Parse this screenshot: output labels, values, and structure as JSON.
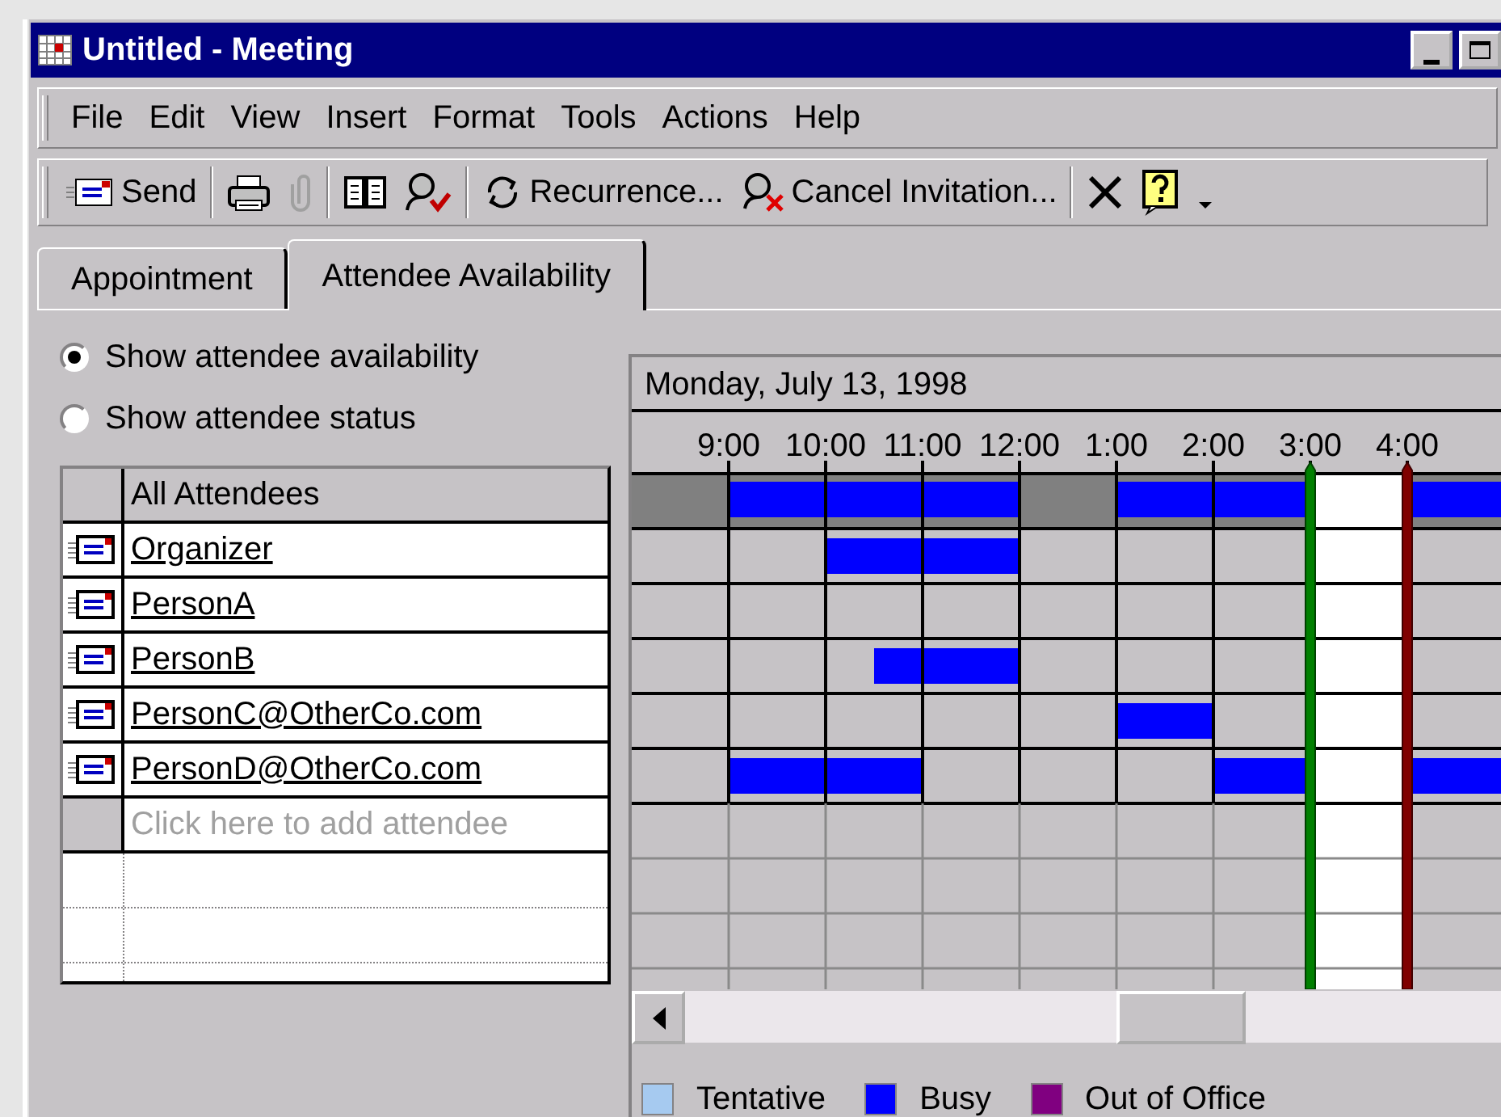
{
  "window": {
    "title": "Untitled - Meeting"
  },
  "menu": [
    "File",
    "Edit",
    "View",
    "Insert",
    "Format",
    "Tools",
    "Actions",
    "Help"
  ],
  "toolbar": [
    {
      "kind": "send",
      "label": "Send"
    },
    {
      "kind": "separator"
    },
    {
      "kind": "print"
    },
    {
      "kind": "attach",
      "disabled": true
    },
    {
      "kind": "separator"
    },
    {
      "kind": "addressbook"
    },
    {
      "kind": "checknames"
    },
    {
      "kind": "separator"
    },
    {
      "kind": "recurrence",
      "label": "Recurrence..."
    },
    {
      "kind": "cancel",
      "label": "Cancel Invitation..."
    },
    {
      "kind": "separator"
    },
    {
      "kind": "delete"
    },
    {
      "kind": "help"
    },
    {
      "kind": "more"
    }
  ],
  "tabs": [
    {
      "label": "Appointment",
      "selected": false
    },
    {
      "label": "Attendee Availability",
      "selected": true
    }
  ],
  "view_options": [
    {
      "label": "Show attendee availability",
      "selected": true
    },
    {
      "label": "Show attendee status",
      "selected": false
    }
  ],
  "attendees": {
    "header": "All Attendees",
    "placeholder": "Click here to add attendee",
    "rows": [
      {
        "name": "Organizer"
      },
      {
        "name": "PersonA"
      },
      {
        "name": "PersonB"
      },
      {
        "name": "PersonC@OtherCo.com"
      },
      {
        "name": "PersonD@OtherCo.com"
      }
    ]
  },
  "schedule": {
    "date": "Monday, July 13, 1998",
    "times": [
      {
        "label": "9:00",
        "selected": false
      },
      {
        "label": "10:00",
        "selected": false
      },
      {
        "label": "11:00",
        "selected": false
      },
      {
        "label": "12:00",
        "selected": false
      },
      {
        "label": "1:00",
        "selected": false
      },
      {
        "label": "2:00",
        "selected": false
      },
      {
        "label": "3:00",
        "selected": true
      },
      {
        "label": "4:00",
        "selected": false
      }
    ],
    "all_busy": [
      false,
      false,
      true,
      true,
      true,
      true,
      true,
      true,
      false,
      false,
      true,
      true,
      true,
      true,
      false,
      false,
      true,
      true
    ],
    "rows": [
      {
        "busy": [
          false,
          false,
          false,
          false,
          true,
          true,
          true,
          true,
          false,
          false,
          false,
          false,
          false,
          false,
          false,
          false,
          false,
          false
        ]
      },
      {
        "busy": [
          false,
          false,
          false,
          false,
          false,
          false,
          false,
          false,
          false,
          false,
          false,
          false,
          false,
          false,
          false,
          false,
          false,
          false
        ]
      },
      {
        "busy": [
          false,
          false,
          false,
          false,
          false,
          true,
          true,
          true,
          false,
          false,
          false,
          false,
          false,
          false,
          false,
          false,
          false,
          false
        ]
      },
      {
        "busy": [
          false,
          false,
          false,
          false,
          false,
          false,
          false,
          false,
          false,
          false,
          true,
          true,
          false,
          false,
          false,
          false,
          false,
          false
        ]
      },
      {
        "busy": [
          false,
          false,
          true,
          true,
          true,
          true,
          false,
          false,
          false,
          false,
          false,
          false,
          true,
          true,
          false,
          false,
          true,
          true
        ]
      }
    ]
  },
  "legend": [
    {
      "label": "Tentative",
      "color": "#a6caf0"
    },
    {
      "label": "Busy",
      "color": "#0000ff"
    },
    {
      "label": "Out of Office",
      "color": "#800080"
    }
  ]
}
